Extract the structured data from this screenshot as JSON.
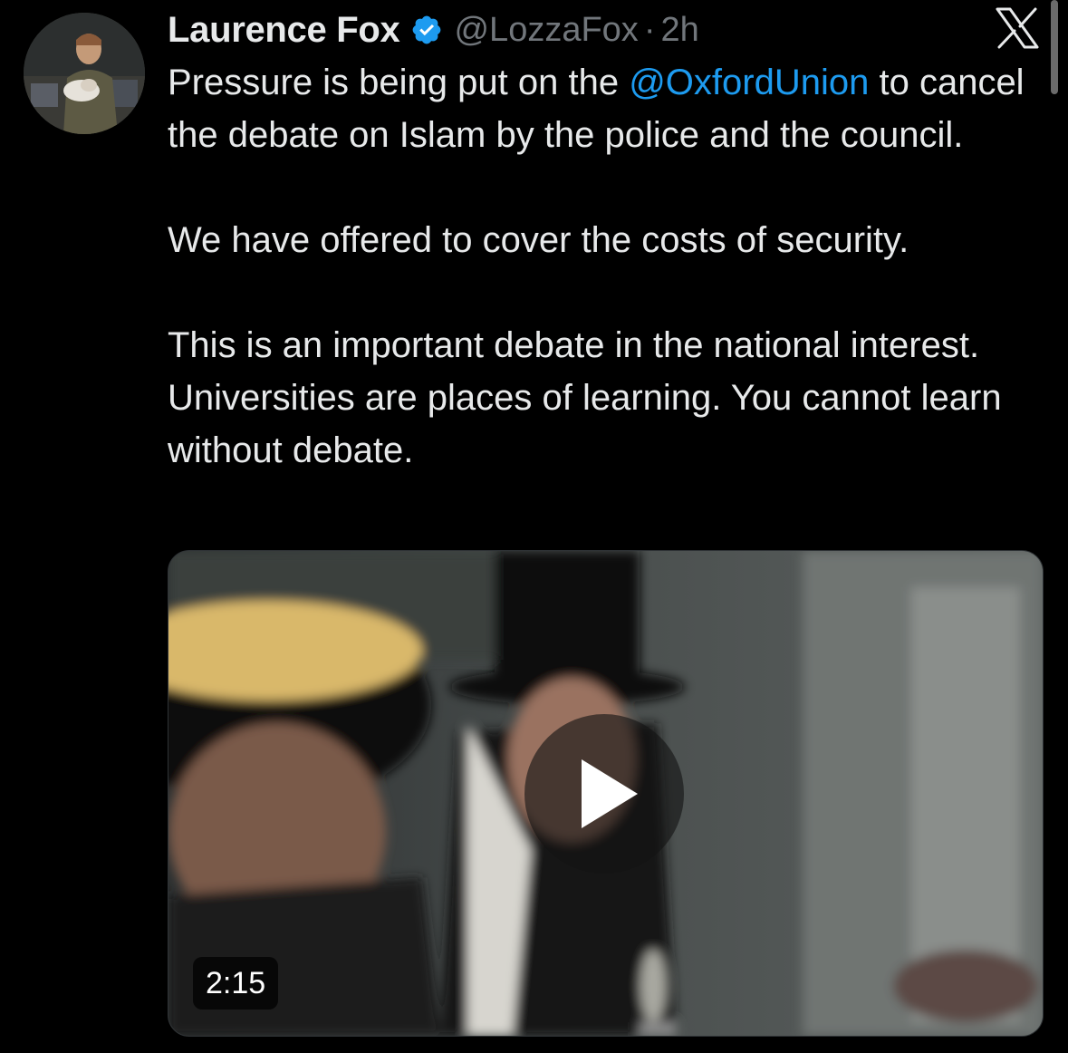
{
  "tweet": {
    "author_name": "Laurence Fox",
    "handle": "@LozzaFox",
    "separator": "·",
    "time": "2h",
    "text_part1": "Pressure is being put on the ",
    "mention": "@OxfordUnion",
    "text_part2": " to cancel the debate on Islam by the police and the council.",
    "paragraph2": "We have offered to cover the costs of security.",
    "paragraph3": "This is an important debate in the national interest. Universities are places of learning. You cannot learn without debate."
  },
  "video": {
    "duration": "2:15"
  },
  "icons": {
    "verified": "verified-badge-icon",
    "brand": "x-logo-icon",
    "play": "play-icon"
  },
  "colors": {
    "background": "#000000",
    "text": "#e7e9ea",
    "secondary": "#71767b",
    "accent": "#1d9bf0"
  }
}
